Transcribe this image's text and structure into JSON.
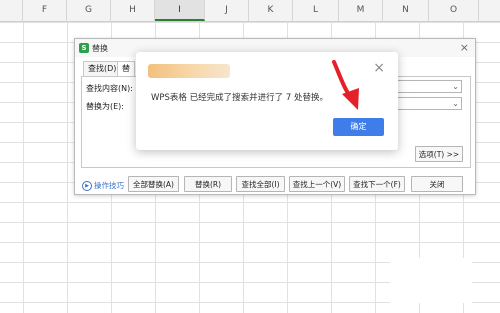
{
  "columns": [
    "F",
    "G",
    "H",
    "I",
    "J",
    "K",
    "L",
    "M",
    "N",
    "O"
  ],
  "active_column": "I",
  "replace_dialog": {
    "title": "替换",
    "tabs": [
      "查找(D)",
      "替"
    ],
    "find_label": "查找内容(N):",
    "replace_label": "替换为(E):",
    "options_label": "选项(T) >>",
    "tips_label": "操作技巧",
    "buttons": {
      "replace_all": "全部替换(A)",
      "replace": "替换(R)",
      "find_all": "查找全部(I)",
      "find_prev": "查找上一个(V)",
      "find_next": "查找下一个(F)",
      "close": "关闭"
    }
  },
  "message_box": {
    "message": "WPS表格 已经完成了搜索并进行了 7 处替换。",
    "ok_label": "确定"
  },
  "colors": {
    "accent_green": "#2e7d32",
    "ok_button": "#3f7ee8",
    "link": "#3b73c9",
    "annotation_arrow": "#e5202a"
  },
  "icons": [
    "close-icon",
    "app-icon",
    "dropdown-arrow-icon",
    "tips-icon",
    "annotation-arrow"
  ]
}
